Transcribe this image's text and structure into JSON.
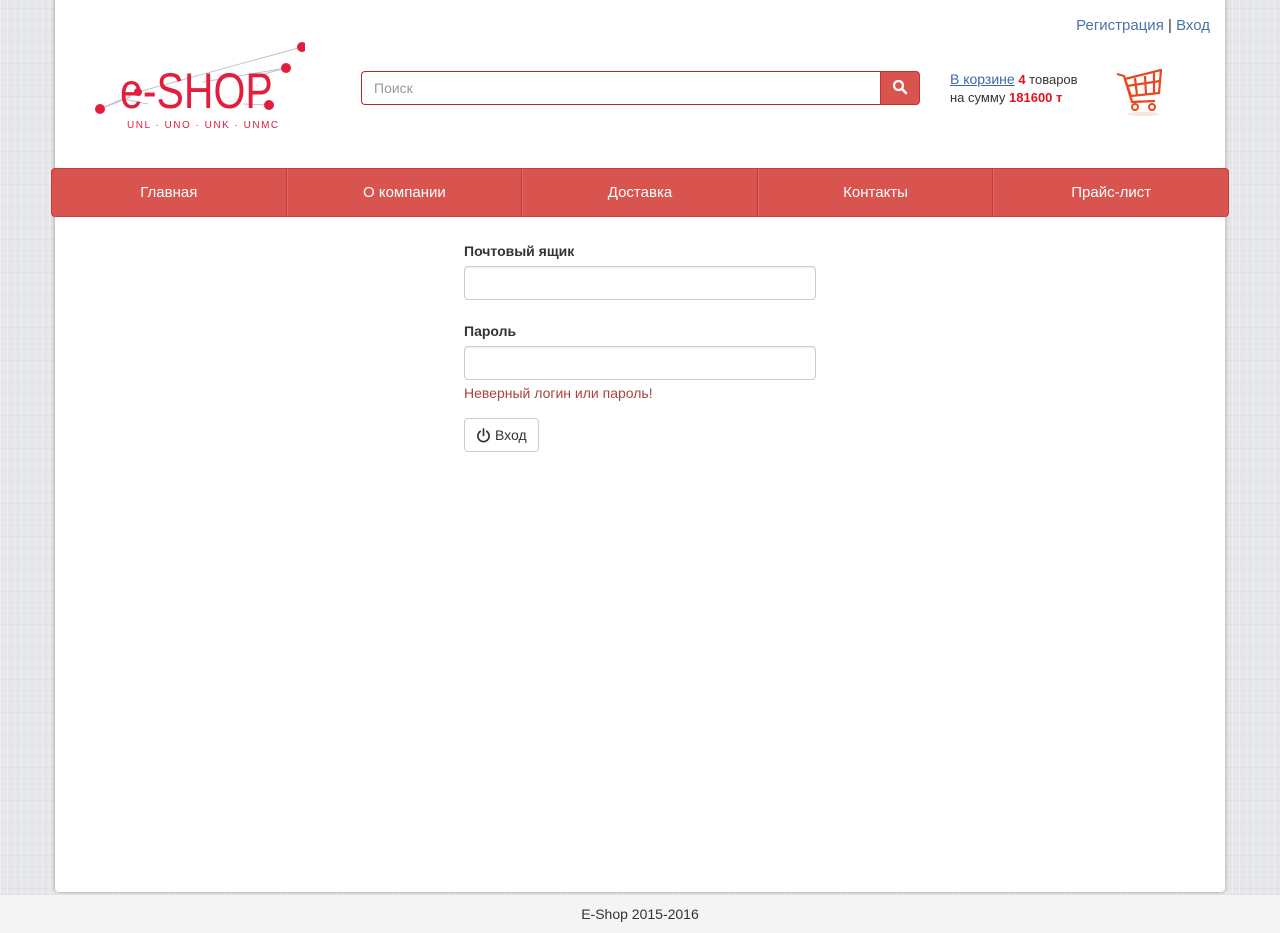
{
  "header": {
    "register_link": "Регистрация",
    "separator": "|",
    "login_link": "Вход",
    "logo": {
      "brand": "e-SHOP",
      "tagline": "UNL · UNO · UNK · UNMC",
      "color": "#e31e3c"
    },
    "search": {
      "placeholder": "Поиск",
      "icon": "search-icon"
    },
    "cart": {
      "link_text": "В корзине",
      "count": "4",
      "count_suffix": "товаров",
      "sum_prefix": "на сумму",
      "sum_value": "181600 т",
      "icon": "shopping-cart-icon"
    }
  },
  "nav": {
    "items": [
      {
        "label": "Главная"
      },
      {
        "label": "О компании"
      },
      {
        "label": "Доставка"
      },
      {
        "label": "Контакты"
      },
      {
        "label": "Прайс-лист"
      }
    ],
    "color": "#d9534f"
  },
  "form": {
    "email_label": "Почтовый ящик",
    "email_value": "",
    "password_label": "Пароль",
    "password_value": "",
    "error_message": "Неверный логин или пароль!",
    "submit_label": "Вход",
    "submit_icon": "power-icon",
    "error_color": "#a94442"
  },
  "footer": {
    "text": "E-Shop 2015-2016"
  }
}
